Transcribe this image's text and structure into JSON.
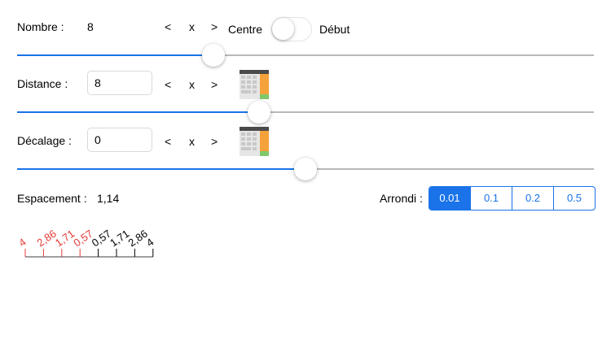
{
  "rows": {
    "nombre": {
      "label": "Nombre :",
      "value": "8",
      "prev": "<",
      "clear": "x",
      "next": ">",
      "slider_fraction": 0.34
    },
    "distance": {
      "label": "Distance :",
      "value": "8",
      "prev": "<",
      "clear": "x",
      "next": ">",
      "slider_fraction": 0.42
    },
    "decalage": {
      "label": "Décalage :",
      "value": "0",
      "prev": "<",
      "clear": "x",
      "next": ">",
      "slider_fraction": 0.5
    }
  },
  "alignment": {
    "left_label": "Centre",
    "right_label": "Début",
    "toggle_on": false
  },
  "espacement": {
    "label": "Espacement :",
    "value": "1,14"
  },
  "arrondi": {
    "label": "Arrondi :",
    "options": [
      "0.01",
      "0.1",
      "0.2",
      "0.5"
    ],
    "selected": 0
  },
  "ruler": {
    "ticks": [
      {
        "label": "4",
        "color": "#e53935"
      },
      {
        "label": "2,86",
        "color": "#e53935"
      },
      {
        "label": "1,71",
        "color": "#e53935"
      },
      {
        "label": "0,57",
        "color": "#e53935"
      },
      {
        "label": "0,57",
        "color": "#000000"
      },
      {
        "label": "1,71",
        "color": "#000000"
      },
      {
        "label": "2,86",
        "color": "#000000"
      },
      {
        "label": "4",
        "color": "#000000"
      }
    ]
  },
  "colors": {
    "accent": "#1a73e8",
    "negative": "#e53935",
    "track": "#b8b8b8"
  },
  "icons": {
    "calculator": "calculator-icon"
  }
}
